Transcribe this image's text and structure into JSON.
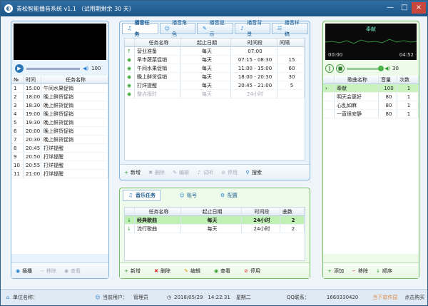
{
  "app": {
    "title": "青松智能播音系统 v1.1  （试用期剩余 30 天）",
    "min": "—",
    "max": "□",
    "close": "×"
  },
  "left": {
    "volume": "100",
    "columns": [
      "№",
      "时间",
      "任务名称"
    ],
    "rows": [
      {
        "n": "1",
        "time": "15:00",
        "name": "午间水果促销"
      },
      {
        "n": "2",
        "time": "18:00",
        "name": "晚上鲜货促销"
      },
      {
        "n": "3",
        "time": "18:30",
        "name": "晚上鲜货促销"
      },
      {
        "n": "4",
        "time": "19:00",
        "name": "晚上鲜货促销"
      },
      {
        "n": "5",
        "time": "19:30",
        "name": "晚上鲜货促销"
      },
      {
        "n": "6",
        "time": "20:00",
        "name": "晚上鲜货促销"
      },
      {
        "n": "7",
        "time": "20:30",
        "name": "晚上鲜货促销"
      },
      {
        "n": "8",
        "time": "20:45",
        "name": "打烊提醒"
      },
      {
        "n": "9",
        "time": "20:50",
        "name": "打烊提醒"
      },
      {
        "n": "10",
        "time": "20:55",
        "name": "打烊提醒"
      },
      {
        "n": "11",
        "time": "21:00",
        "name": "打烊提醒"
      }
    ],
    "toolbar": {
      "insert": "插播",
      "remove": "移除",
      "view": "查看"
    }
  },
  "center": {
    "tabs": [
      "播音任务",
      "播音角色",
      "播音提示",
      "播音背景",
      "播音样稿"
    ],
    "columns": [
      "任务名称",
      "起止日期",
      "时间段",
      "间隔"
    ],
    "rows": [
      {
        "name": "营业准备",
        "date": "每天",
        "time": "07:00",
        "gap": ""
      },
      {
        "name": "早市蔬菜促销",
        "date": "每天",
        "time": "07:15 - 08:30",
        "gap": "15"
      },
      {
        "name": "午间水果促销",
        "date": "每天",
        "time": "11:00 - 15:00",
        "gap": "60"
      },
      {
        "name": "晚上鲜货促销",
        "date": "每天",
        "time": "18:00 - 20:30",
        "gap": "30"
      },
      {
        "name": "打烊提醒",
        "date": "每天",
        "time": "20:45 - 21:00",
        "gap": "5"
      },
      {
        "name": "整点报时",
        "date": "每天",
        "time": "24小时",
        "gap": ""
      }
    ],
    "toolbar": {
      "add": "新增",
      "del": "删除",
      "edit": "编辑",
      "listen": "试听",
      "stop": "停用",
      "search": "搜索"
    }
  },
  "music": {
    "tabs": [
      "音乐任务",
      "账号",
      "配置"
    ],
    "columns": [
      "任务名称",
      "起止日期",
      "时间段",
      "曲数"
    ],
    "rows": [
      {
        "name": "经典歌曲",
        "date": "每天",
        "time": "24小时",
        "count": "2"
      },
      {
        "name": "流行歌曲",
        "date": "每天",
        "time": "24小时",
        "count": "2"
      }
    ],
    "toolbar": {
      "add": "新增",
      "del": "删除",
      "edit": "编辑",
      "view": "查看",
      "stop": "停用"
    }
  },
  "right": {
    "now": "奉献",
    "elapsed": "00:00",
    "total": "04:52",
    "volume": "30",
    "columns": [
      "歌曲名称",
      "音量",
      "次数"
    ],
    "rows": [
      {
        "name": "奉献",
        "vol": "100",
        "count": "1"
      },
      {
        "name": "明天会更好",
        "vol": "80",
        "count": "1"
      },
      {
        "name": "心乱如麻",
        "vol": "80",
        "count": "1"
      },
      {
        "name": "一直很安静",
        "vol": "80",
        "count": "1"
      }
    ],
    "toolbar": {
      "add": "添加",
      "remove": "移除",
      "order": "顺序"
    }
  },
  "status": {
    "unit_label": "单位名称：",
    "user_label": "当前用户：",
    "user": "管理员",
    "date": "2018/05/29",
    "time": "14:22:31",
    "weekday": "星期二",
    "qq_label": "QQ联系：",
    "qq": "1660330420",
    "tag1": "当下软件园",
    "tag2": "点击购买"
  },
  "colors": {
    "title_bg": "#1c5588",
    "accent_blue": "#247fd0",
    "accent_green": "#4cb34a"
  }
}
